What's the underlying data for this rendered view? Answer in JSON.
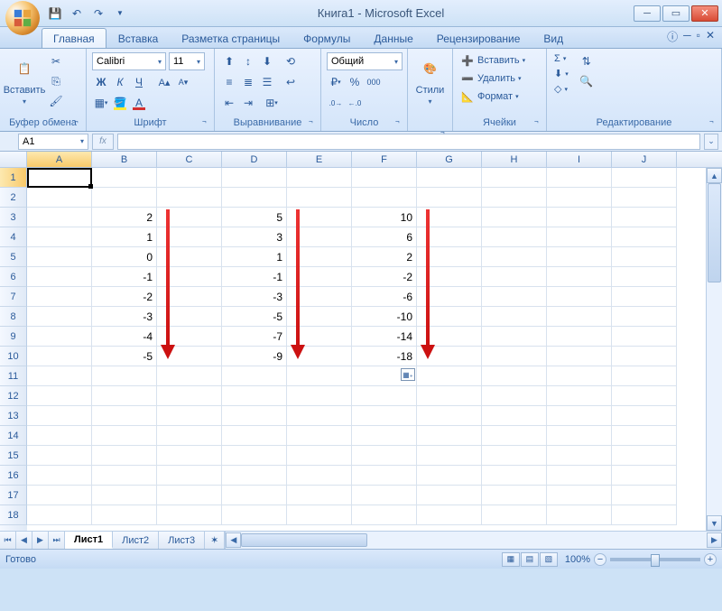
{
  "title": "Книга1 - Microsoft Excel",
  "tabs": [
    "Главная",
    "Вставка",
    "Разметка страницы",
    "Формулы",
    "Данные",
    "Рецензирование",
    "Вид"
  ],
  "activeTab": 0,
  "ribbon": {
    "clipboard": {
      "label": "Буфер обмена",
      "paste": "Вставить"
    },
    "font": {
      "label": "Шрифт",
      "name": "Calibri",
      "size": "11",
      "bold": "Ж",
      "italic": "К",
      "underline": "Ч"
    },
    "alignment": {
      "label": "Выравнивание"
    },
    "number": {
      "label": "Число",
      "format": "Общий"
    },
    "styles": {
      "label": "Стили",
      "btn": "Стили"
    },
    "cells": {
      "label": "Ячейки",
      "insert": "Вставить",
      "delete": "Удалить",
      "format": "Формат"
    },
    "editing": {
      "label": "Редактирование"
    }
  },
  "namebox": "A1",
  "columns": [
    "A",
    "B",
    "C",
    "D",
    "E",
    "F",
    "G",
    "H",
    "I",
    "J"
  ],
  "rowCount": 18,
  "cellsData": {
    "3": {
      "B": "2",
      "D": "5",
      "F": "10"
    },
    "4": {
      "B": "1",
      "D": "3",
      "F": "6"
    },
    "5": {
      "B": "0",
      "D": "1",
      "F": "2"
    },
    "6": {
      "B": "-1",
      "D": "-1",
      "F": "-2"
    },
    "7": {
      "B": "-2",
      "D": "-3",
      "F": "-6"
    },
    "8": {
      "B": "-3",
      "D": "-5",
      "F": "-10"
    },
    "9": {
      "B": "-4",
      "D": "-7",
      "F": "-14"
    },
    "10": {
      "B": "-5",
      "D": "-9",
      "F": "-18"
    }
  },
  "sheets": [
    "Лист1",
    "Лист2",
    "Лист3"
  ],
  "activeSheet": 0,
  "status": "Готово",
  "zoom": "100%"
}
